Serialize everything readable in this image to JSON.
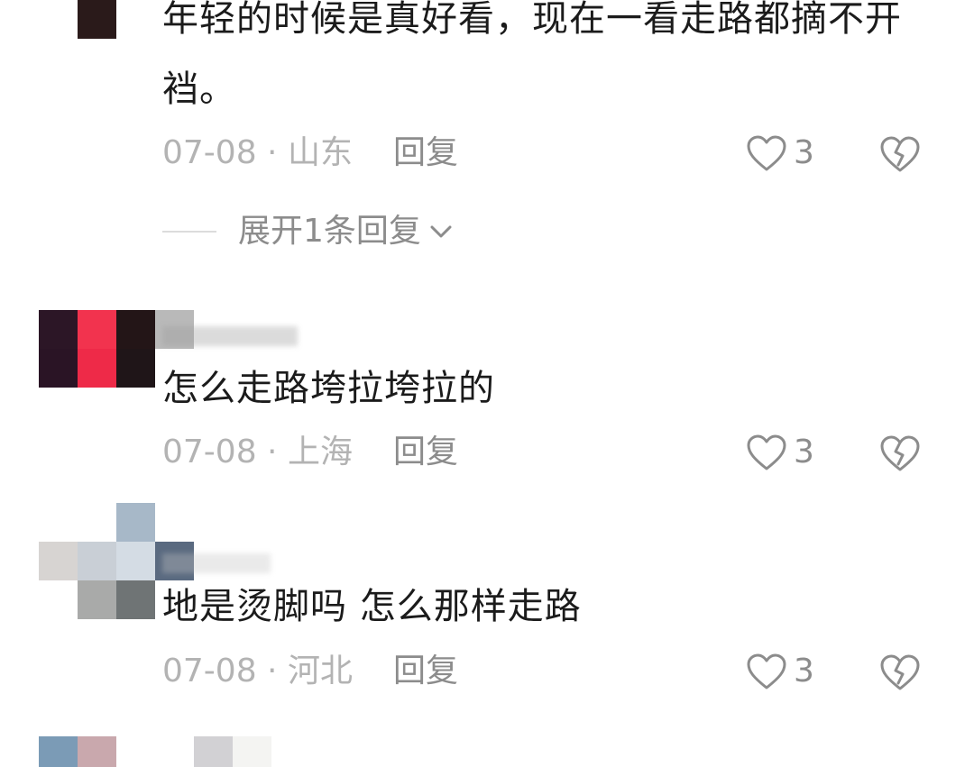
{
  "comments": [
    {
      "text": "年轻的时候是真好看，现在一看走路都摘不开裆。",
      "date": "07-08 · 山东",
      "reply_label": "回复",
      "likes": "3",
      "expand_label": "展开1条回复"
    },
    {
      "text": "怎么走路垮拉垮拉的",
      "date": "07-08 · 上海",
      "reply_label": "回复",
      "likes": "3"
    },
    {
      "text": "地是烫脚吗 怎么那样走路",
      "date": "07-08 · 河北",
      "reply_label": "回复",
      "likes": "3"
    }
  ],
  "colors": {
    "text": "#1b1b1b",
    "meta": "#b3b3b3",
    "icon": "#8c8c8c"
  },
  "icons": {
    "like": "heart-outline-icon",
    "dislike": "broken-heart-icon",
    "expand": "chevron-down-icon"
  }
}
